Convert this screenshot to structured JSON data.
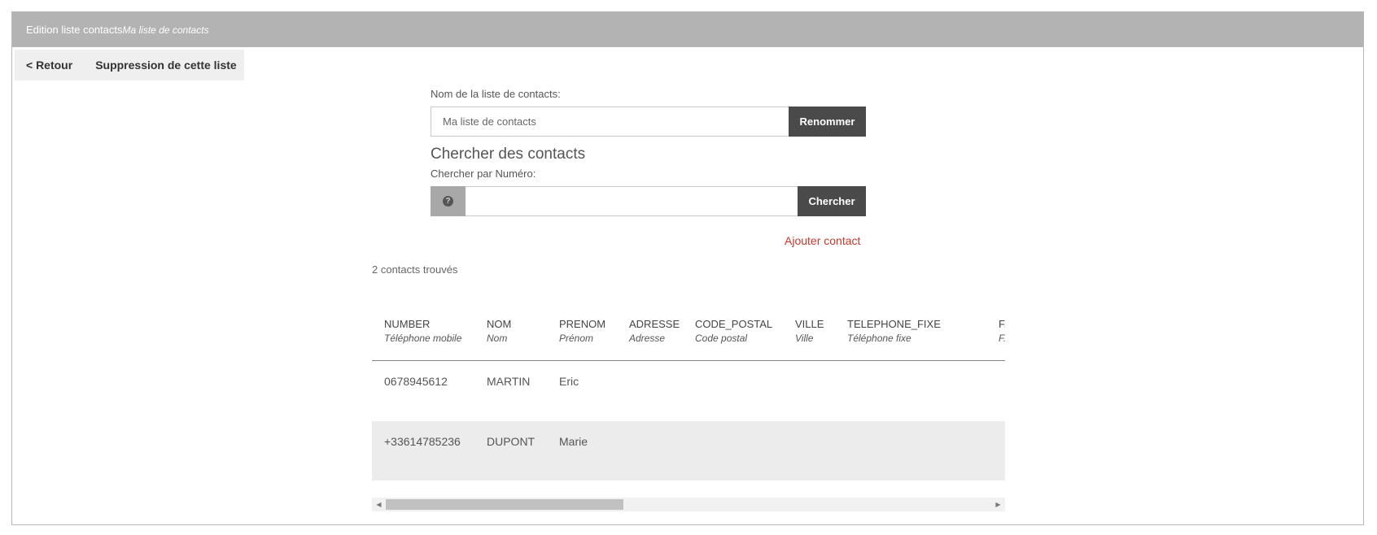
{
  "header": {
    "title": "Edition liste contacts",
    "subtitle": "Ma liste de contacts"
  },
  "actions": {
    "back": "< Retour",
    "delete": "Suppression de cette liste"
  },
  "rename": {
    "label": "Nom de la liste de contacts:",
    "value": "Ma liste de contacts",
    "button": "Renommer"
  },
  "search": {
    "title": "Chercher des contacts",
    "label": "Chercher par Numéro:",
    "value": "",
    "help_glyph": "?",
    "button": "Chercher"
  },
  "add_contact": "Ajouter contact",
  "results_count": "2 contacts trouvés",
  "table": {
    "columns": [
      {
        "key": "NUMBER",
        "label": "Téléphone mobile"
      },
      {
        "key": "NOM",
        "label": "Nom"
      },
      {
        "key": "PRENOM",
        "label": "Prénom"
      },
      {
        "key": "ADRESSE",
        "label": "Adresse"
      },
      {
        "key": "CODE_POSTAL",
        "label": "Code postal"
      },
      {
        "key": "VILLE",
        "label": "Ville"
      },
      {
        "key": "TELEPHONE_FIXE",
        "label": "Téléphone fixe"
      },
      {
        "key": "F...",
        "label": "F..."
      }
    ],
    "rows": [
      [
        "0678945612",
        "MARTIN",
        "Eric",
        "",
        "",
        "",
        "",
        ""
      ],
      [
        "+33614785236",
        "DUPONT",
        "Marie",
        "",
        "",
        "",
        "",
        ""
      ]
    ]
  },
  "scrollbar": {
    "left_arrow": "◀",
    "right_arrow": "▶"
  },
  "colors": {
    "header_bg": "#b3b3b3",
    "dark_button": "#4a4a4a",
    "link_red": "#c0392b"
  }
}
